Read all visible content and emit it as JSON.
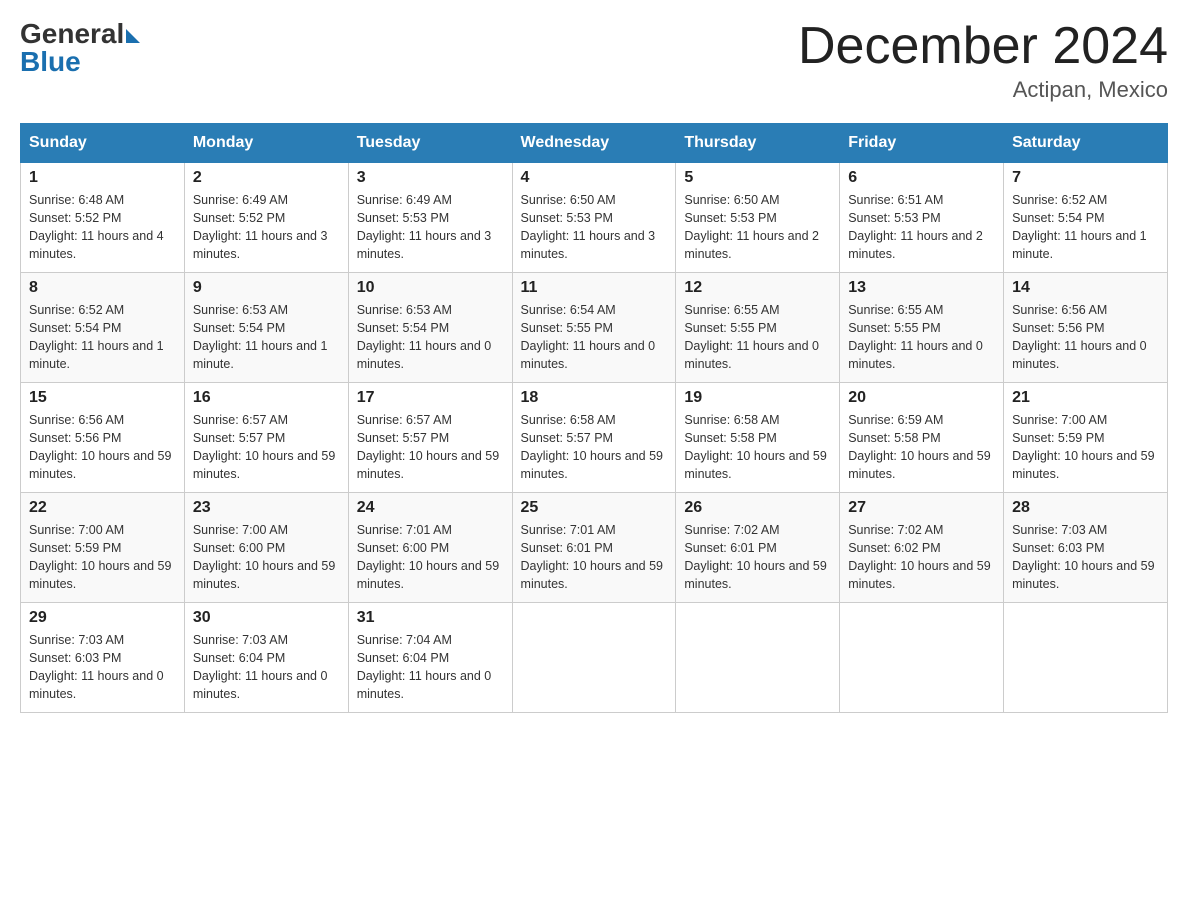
{
  "header": {
    "logo_general": "General",
    "logo_blue": "Blue",
    "month_title": "December 2024",
    "location": "Actipan, Mexico"
  },
  "days_of_week": [
    "Sunday",
    "Monday",
    "Tuesday",
    "Wednesday",
    "Thursday",
    "Friday",
    "Saturday"
  ],
  "weeks": [
    [
      {
        "day": "1",
        "sunrise": "6:48 AM",
        "sunset": "5:52 PM",
        "daylight": "11 hours and 4 minutes."
      },
      {
        "day": "2",
        "sunrise": "6:49 AM",
        "sunset": "5:52 PM",
        "daylight": "11 hours and 3 minutes."
      },
      {
        "day": "3",
        "sunrise": "6:49 AM",
        "sunset": "5:53 PM",
        "daylight": "11 hours and 3 minutes."
      },
      {
        "day": "4",
        "sunrise": "6:50 AM",
        "sunset": "5:53 PM",
        "daylight": "11 hours and 3 minutes."
      },
      {
        "day": "5",
        "sunrise": "6:50 AM",
        "sunset": "5:53 PM",
        "daylight": "11 hours and 2 minutes."
      },
      {
        "day": "6",
        "sunrise": "6:51 AM",
        "sunset": "5:53 PM",
        "daylight": "11 hours and 2 minutes."
      },
      {
        "day": "7",
        "sunrise": "6:52 AM",
        "sunset": "5:54 PM",
        "daylight": "11 hours and 1 minute."
      }
    ],
    [
      {
        "day": "8",
        "sunrise": "6:52 AM",
        "sunset": "5:54 PM",
        "daylight": "11 hours and 1 minute."
      },
      {
        "day": "9",
        "sunrise": "6:53 AM",
        "sunset": "5:54 PM",
        "daylight": "11 hours and 1 minute."
      },
      {
        "day": "10",
        "sunrise": "6:53 AM",
        "sunset": "5:54 PM",
        "daylight": "11 hours and 0 minutes."
      },
      {
        "day": "11",
        "sunrise": "6:54 AM",
        "sunset": "5:55 PM",
        "daylight": "11 hours and 0 minutes."
      },
      {
        "day": "12",
        "sunrise": "6:55 AM",
        "sunset": "5:55 PM",
        "daylight": "11 hours and 0 minutes."
      },
      {
        "day": "13",
        "sunrise": "6:55 AM",
        "sunset": "5:55 PM",
        "daylight": "11 hours and 0 minutes."
      },
      {
        "day": "14",
        "sunrise": "6:56 AM",
        "sunset": "5:56 PM",
        "daylight": "11 hours and 0 minutes."
      }
    ],
    [
      {
        "day": "15",
        "sunrise": "6:56 AM",
        "sunset": "5:56 PM",
        "daylight": "10 hours and 59 minutes."
      },
      {
        "day": "16",
        "sunrise": "6:57 AM",
        "sunset": "5:57 PM",
        "daylight": "10 hours and 59 minutes."
      },
      {
        "day": "17",
        "sunrise": "6:57 AM",
        "sunset": "5:57 PM",
        "daylight": "10 hours and 59 minutes."
      },
      {
        "day": "18",
        "sunrise": "6:58 AM",
        "sunset": "5:57 PM",
        "daylight": "10 hours and 59 minutes."
      },
      {
        "day": "19",
        "sunrise": "6:58 AM",
        "sunset": "5:58 PM",
        "daylight": "10 hours and 59 minutes."
      },
      {
        "day": "20",
        "sunrise": "6:59 AM",
        "sunset": "5:58 PM",
        "daylight": "10 hours and 59 minutes."
      },
      {
        "day": "21",
        "sunrise": "7:00 AM",
        "sunset": "5:59 PM",
        "daylight": "10 hours and 59 minutes."
      }
    ],
    [
      {
        "day": "22",
        "sunrise": "7:00 AM",
        "sunset": "5:59 PM",
        "daylight": "10 hours and 59 minutes."
      },
      {
        "day": "23",
        "sunrise": "7:00 AM",
        "sunset": "6:00 PM",
        "daylight": "10 hours and 59 minutes."
      },
      {
        "day": "24",
        "sunrise": "7:01 AM",
        "sunset": "6:00 PM",
        "daylight": "10 hours and 59 minutes."
      },
      {
        "day": "25",
        "sunrise": "7:01 AM",
        "sunset": "6:01 PM",
        "daylight": "10 hours and 59 minutes."
      },
      {
        "day": "26",
        "sunrise": "7:02 AM",
        "sunset": "6:01 PM",
        "daylight": "10 hours and 59 minutes."
      },
      {
        "day": "27",
        "sunrise": "7:02 AM",
        "sunset": "6:02 PM",
        "daylight": "10 hours and 59 minutes."
      },
      {
        "day": "28",
        "sunrise": "7:03 AM",
        "sunset": "6:03 PM",
        "daylight": "10 hours and 59 minutes."
      }
    ],
    [
      {
        "day": "29",
        "sunrise": "7:03 AM",
        "sunset": "6:03 PM",
        "daylight": "11 hours and 0 minutes."
      },
      {
        "day": "30",
        "sunrise": "7:03 AM",
        "sunset": "6:04 PM",
        "daylight": "11 hours and 0 minutes."
      },
      {
        "day": "31",
        "sunrise": "7:04 AM",
        "sunset": "6:04 PM",
        "daylight": "11 hours and 0 minutes."
      },
      null,
      null,
      null,
      null
    ]
  ]
}
